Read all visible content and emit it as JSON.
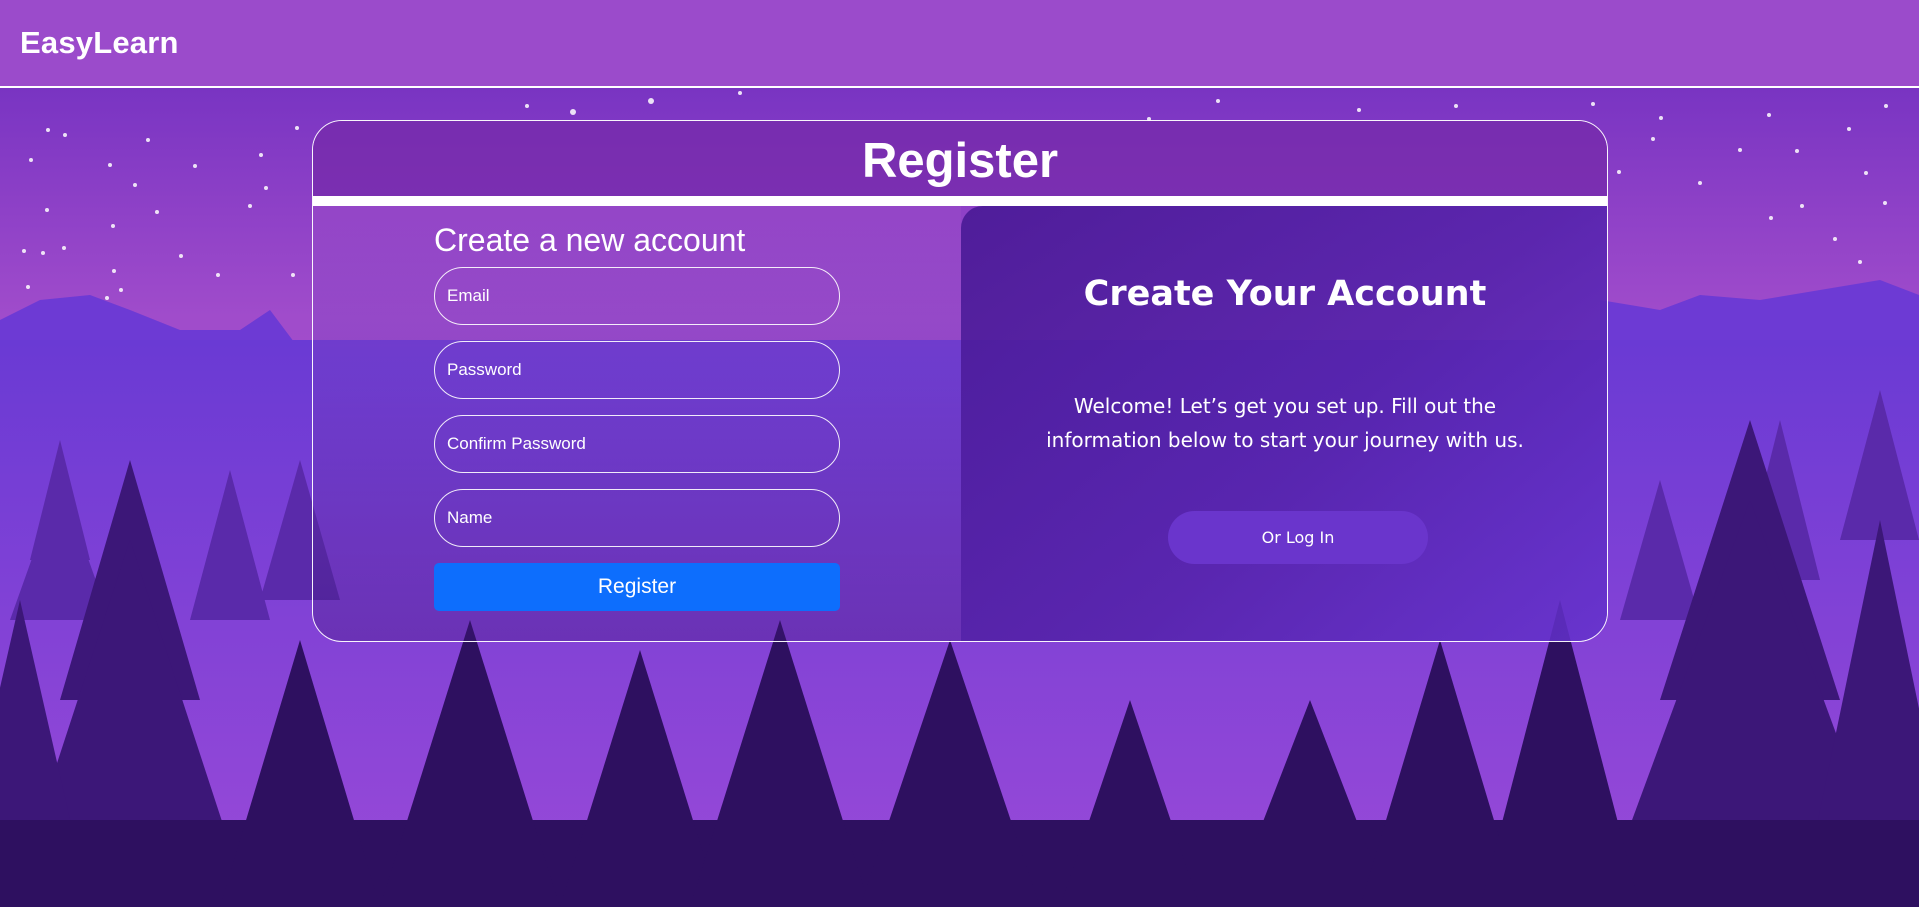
{
  "brand": {
    "name": "EasyLearn"
  },
  "card": {
    "title": "Register",
    "form": {
      "heading": "Create a new account",
      "email_placeholder": "Email",
      "password_placeholder": "Password",
      "confirm_placeholder": "Confirm Password",
      "name_placeholder": "Name",
      "submit_label": "Register"
    },
    "promo": {
      "title": "Create Your Account",
      "text": "Welcome! Let’s get you set up. Fill out the information below to start your journey with us.",
      "login_label": "Or Log In"
    }
  },
  "colors": {
    "topbar": "#9b4bcb",
    "register_button": "#0d6efd",
    "login_button": "#6a35cc"
  }
}
